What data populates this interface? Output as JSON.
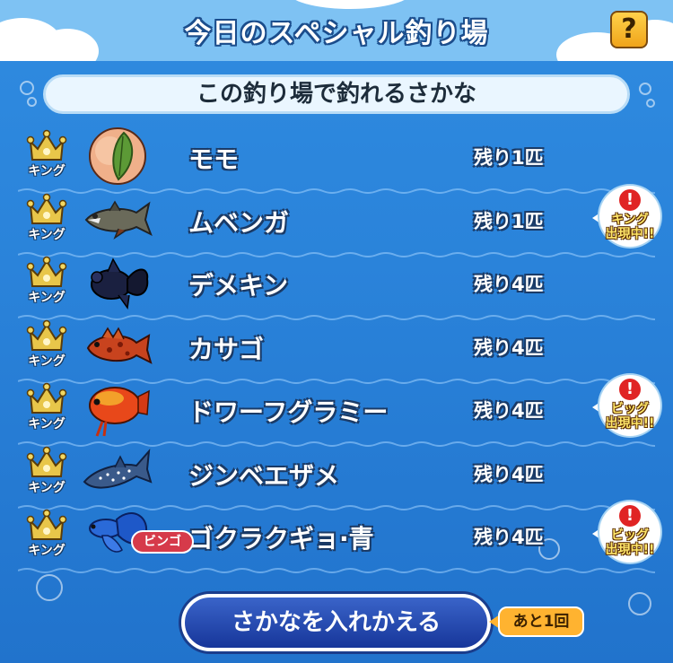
{
  "header": {
    "title": "今日のスペシャル釣り場",
    "help_label": "?"
  },
  "subheader": "この釣り場で釣れるさかな",
  "fish": [
    {
      "name": "モモ",
      "remaining": "残り1匹",
      "rank": "キング",
      "icon": "peach-icon",
      "alert": null,
      "tag": null
    },
    {
      "name": "ムベンガ",
      "remaining": "残り1匹",
      "rank": "キング",
      "icon": "goliath-tigerfish-icon",
      "alert": {
        "line1": "キング",
        "line2": "出現中!!"
      },
      "tag": null
    },
    {
      "name": "デメキン",
      "remaining": "残り4匹",
      "rank": "キング",
      "icon": "black-telescope-goldfish-icon",
      "alert": null,
      "tag": null
    },
    {
      "name": "カサゴ",
      "remaining": "残り4匹",
      "rank": "キング",
      "icon": "scorpionfish-icon",
      "alert": null,
      "tag": null
    },
    {
      "name": "ドワーフグラミー",
      "remaining": "残り4匹",
      "rank": "キング",
      "icon": "dwarf-gourami-icon",
      "alert": {
        "line1": "ビッグ",
        "line2": "出現中!!"
      },
      "tag": null
    },
    {
      "name": "ジンベエザメ",
      "remaining": "残り4匹",
      "rank": "キング",
      "icon": "whale-shark-icon",
      "alert": null,
      "tag": null
    },
    {
      "name": "ゴクラクギョ·青",
      "remaining": "残り4匹",
      "rank": "キング",
      "icon": "blue-betta-icon",
      "alert": {
        "line1": "ビッグ",
        "line2": "出現中!!"
      },
      "tag": "ビンゴ"
    }
  ],
  "footer": {
    "replace_button": "さかなを入れかえる",
    "remaining_count": "あと1回"
  },
  "colors": {
    "background": "#2a83da",
    "title_bar": "#7ec2f3",
    "button": "#17369a",
    "badge": "#ffb330",
    "alert_red": "#e02424"
  }
}
